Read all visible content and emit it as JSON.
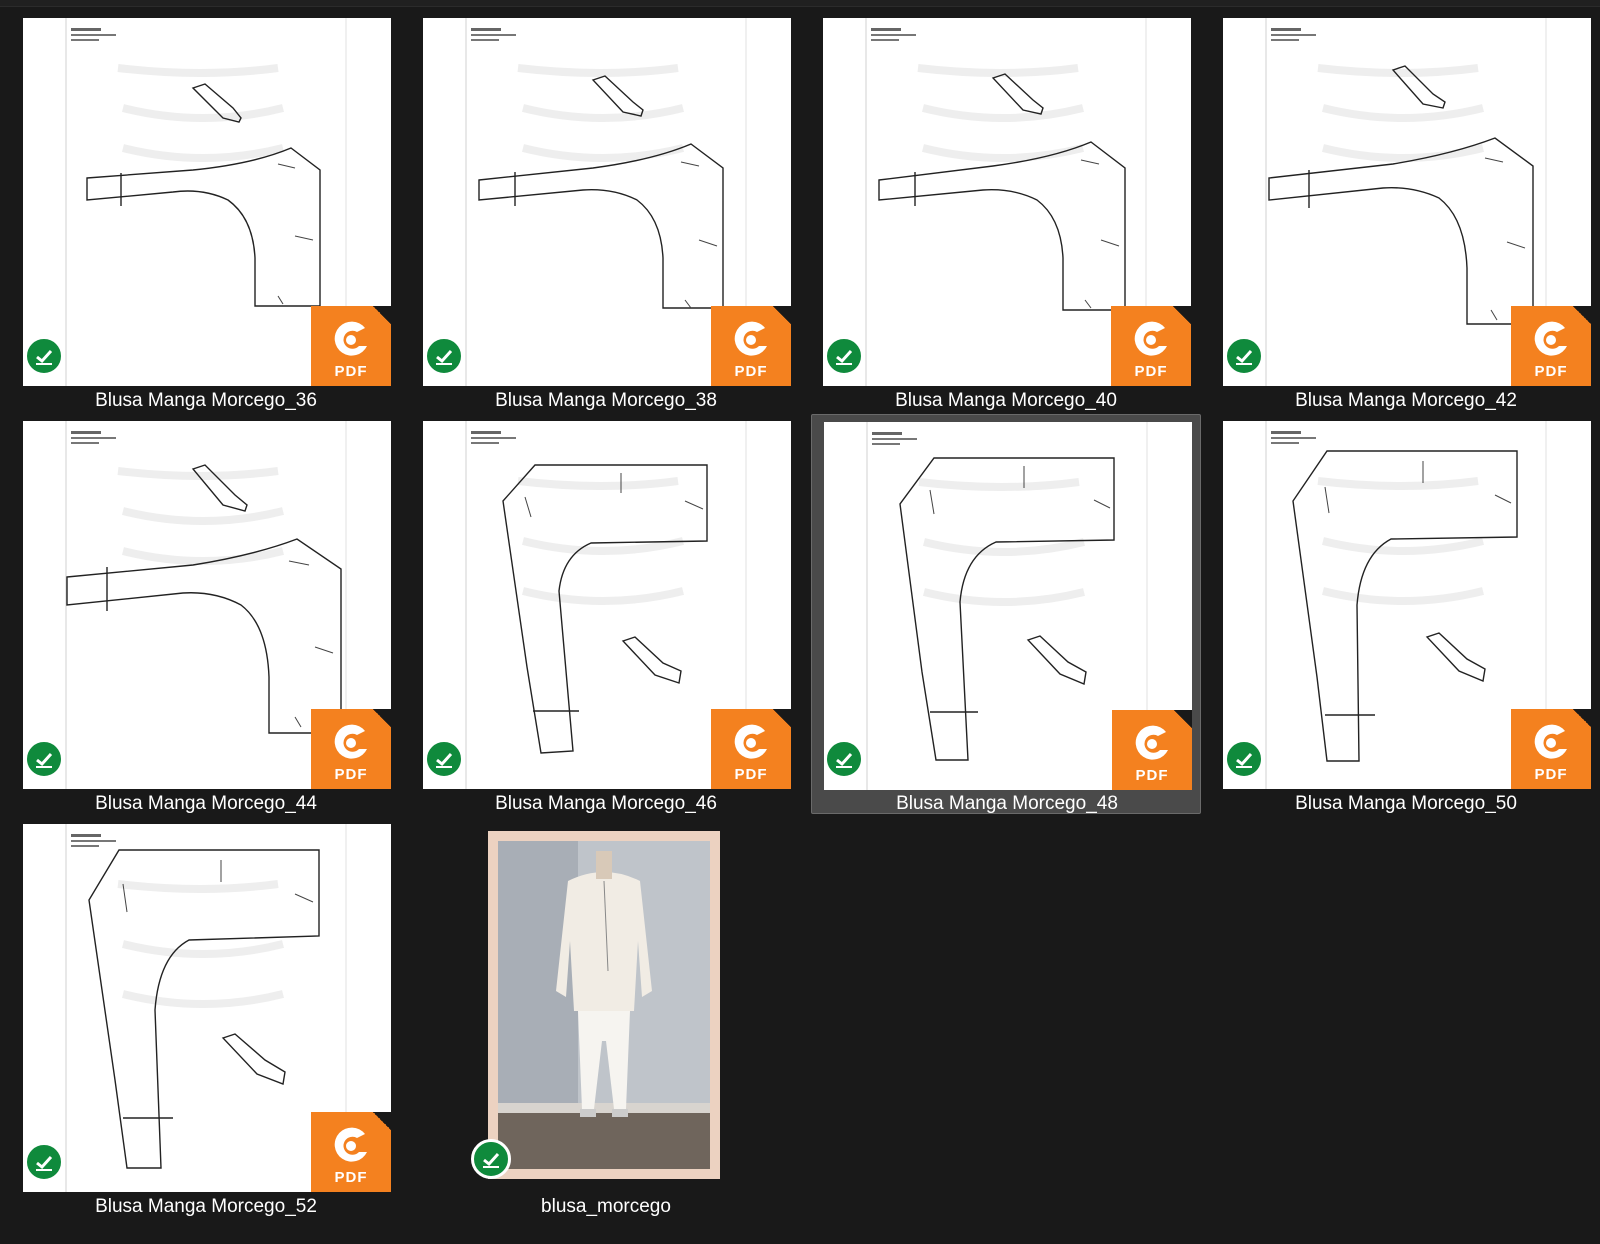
{
  "files": [
    {
      "name": "Blusa Manga Morcego_36",
      "type": "pdf",
      "status": "synced",
      "selected": false,
      "thumb": "sleeve-horizontal"
    },
    {
      "name": "Blusa Manga Morcego_38",
      "type": "pdf",
      "status": "synced",
      "selected": false,
      "thumb": "sleeve-horizontal"
    },
    {
      "name": "Blusa Manga Morcego_40",
      "type": "pdf",
      "status": "synced",
      "selected": false,
      "thumb": "sleeve-horizontal"
    },
    {
      "name": "Blusa Manga Morcego_42",
      "type": "pdf",
      "status": "synced",
      "selected": false,
      "thumb": "sleeve-horizontal"
    },
    {
      "name": "Blusa Manga Morcego_44",
      "type": "pdf",
      "status": "synced",
      "selected": false,
      "thumb": "sleeve-horizontal"
    },
    {
      "name": "Blusa Manga Morcego_46",
      "type": "pdf",
      "status": "synced",
      "selected": false,
      "thumb": "sleeve-vertical"
    },
    {
      "name": "Blusa Manga Morcego_48",
      "type": "pdf",
      "status": "synced",
      "selected": true,
      "thumb": "sleeve-vertical"
    },
    {
      "name": "Blusa Manga Morcego_50",
      "type": "pdf",
      "status": "synced",
      "selected": false,
      "thumb": "sleeve-vertical"
    },
    {
      "name": "Blusa Manga Morcego_52",
      "type": "pdf",
      "status": "synced",
      "selected": false,
      "thumb": "sleeve-vertical"
    },
    {
      "name": "blusa_morcego",
      "type": "image",
      "status": "synced",
      "selected": false,
      "thumb": "photo"
    }
  ],
  "badge": {
    "pdf_label": "PDF"
  },
  "colors": {
    "background": "#191919",
    "pdf_orange": "#f4811f",
    "sync_green": "#0f8a3c",
    "selected_bg": "#4a4a4a"
  },
  "icons": {
    "pdf": "foxit-pdf-icon",
    "status": "check-circle-icon"
  }
}
